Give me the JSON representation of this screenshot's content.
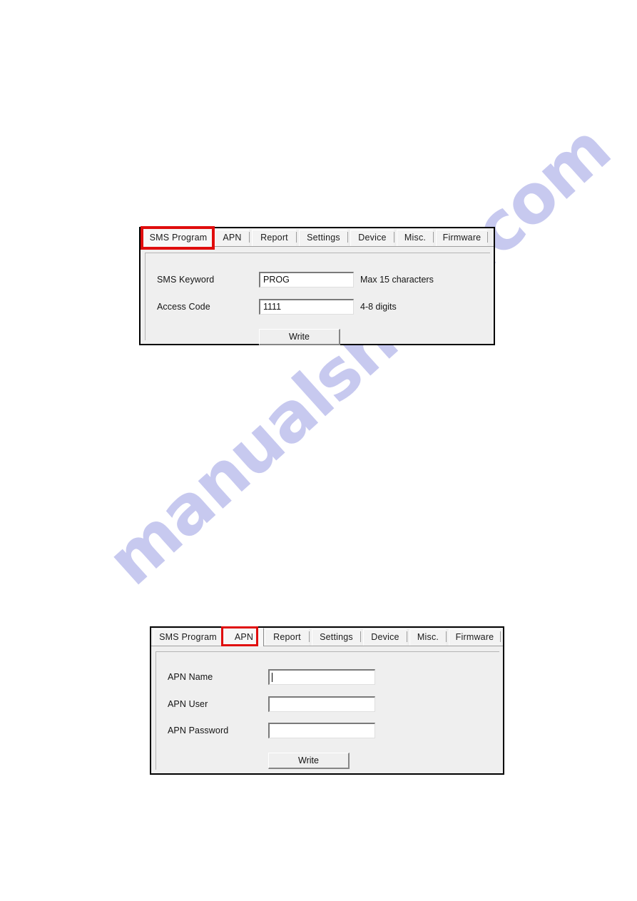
{
  "document": {
    "watermark_text": "manualshive.com",
    "watermark_color": "#c7c9ef",
    "background_color": "#ffffff",
    "highlight_color": "#e00d0d",
    "dialog_background": "#efefef"
  },
  "figure_1": {
    "name": "sms-program-tab-dialog",
    "selected_tab": "SMS Program",
    "tabs": [
      {
        "label": "SMS Program",
        "selected": true
      },
      {
        "label": "APN",
        "selected": false
      },
      {
        "label": "Report",
        "selected": false
      },
      {
        "label": "Settings",
        "selected": false
      },
      {
        "label": "Device",
        "selected": false
      },
      {
        "label": "Misc.",
        "selected": false
      },
      {
        "label": "Firmware",
        "selected": false
      }
    ],
    "fields": [
      {
        "label": "SMS Keyword",
        "value": "PROG",
        "hint": "Max 15 characters",
        "caret": false
      },
      {
        "label": "Access Code",
        "value": "1111",
        "hint": "4-8 digits",
        "caret": false
      }
    ],
    "write_button": "Write"
  },
  "figure_2": {
    "name": "apn-tab-dialog",
    "selected_tab": "APN",
    "tabs": [
      {
        "label": "SMS Program",
        "selected": false
      },
      {
        "label": "APN",
        "selected": true
      },
      {
        "label": "Report",
        "selected": false
      },
      {
        "label": "Settings",
        "selected": false
      },
      {
        "label": "Device",
        "selected": false
      },
      {
        "label": "Misc.",
        "selected": false
      },
      {
        "label": "Firmware",
        "selected": false
      }
    ],
    "fields": [
      {
        "label": "APN Name",
        "value": "",
        "hint": "",
        "caret": true
      },
      {
        "label": "APN User",
        "value": "",
        "hint": "",
        "caret": false
      },
      {
        "label": "APN Password",
        "value": "",
        "hint": "",
        "caret": false
      }
    ],
    "write_button": "Write"
  }
}
